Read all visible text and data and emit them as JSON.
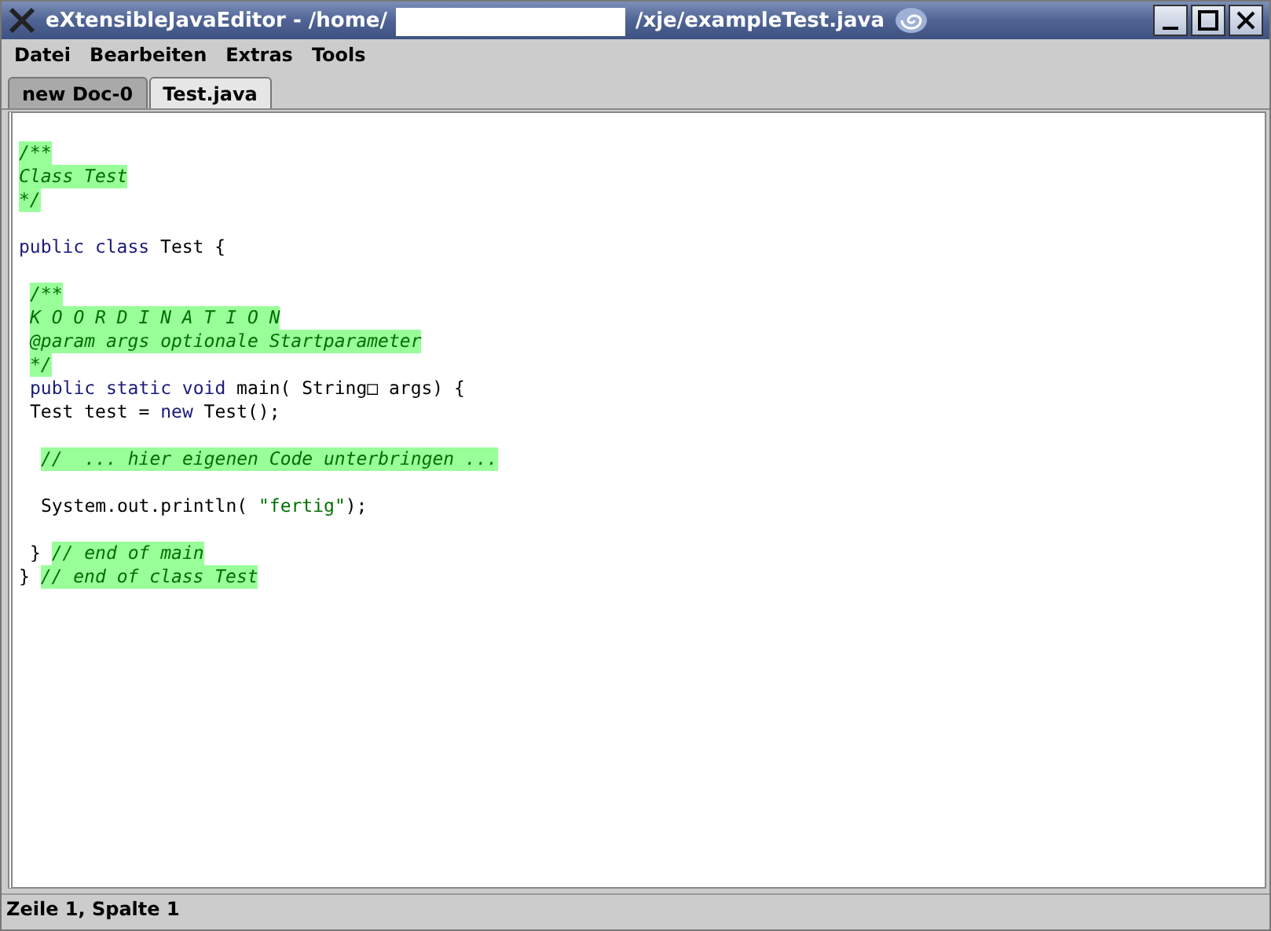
{
  "window": {
    "title_start": "eXtensibleJavaEditor - /home/",
    "title_end": "/xje/exampleTest.java"
  },
  "menu": [
    "Datei",
    "Bearbeiten",
    "Extras",
    "Tools"
  ],
  "tabs": [
    {
      "label": "new Doc-0",
      "selected": false
    },
    {
      "label": "Test.java",
      "selected": true
    }
  ],
  "editor": {
    "lines": [
      {
        "kind": "outer",
        "tokens": [
          {
            "text": "/**",
            "kind": "comment"
          }
        ]
      },
      {
        "kind": "outer",
        "tokens": [
          {
            "text": "Class Test",
            "kind": "comment"
          }
        ]
      },
      {
        "kind": "outer",
        "tokens": [
          {
            "text": "*/",
            "kind": "comment"
          }
        ]
      },
      {
        "kind": "blank"
      },
      {
        "kind": "outer",
        "tokens": [
          {
            "text": "public class",
            "kind": "keyword"
          },
          {
            "text": " Test {",
            "kind": "plain"
          }
        ]
      },
      {
        "kind": "blank"
      },
      {
        "kind": "inner",
        "tokens": [
          {
            "text": "/**",
            "kind": "comment"
          }
        ]
      },
      {
        "kind": "inner",
        "tokens": [
          {
            "text": "K O O R D I N A T I O N",
            "kind": "comment"
          }
        ]
      },
      {
        "kind": "inner",
        "tokens": [
          {
            "text": "@param args optionale Startparameter",
            "kind": "comment"
          }
        ]
      },
      {
        "kind": "inner",
        "tokens": [
          {
            "text": "*/",
            "kind": "comment"
          }
        ]
      },
      {
        "kind": "inner",
        "tokens": [
          {
            "text": "public static void",
            "kind": "keyword"
          },
          {
            "text": " main( String□ args) {",
            "kind": "plain"
          }
        ]
      },
      {
        "kind": "inner",
        "tokens": [
          {
            "text": "Test test = ",
            "kind": "plain"
          },
          {
            "text": "new",
            "kind": "keyword"
          },
          {
            "text": " Test();",
            "kind": "plain"
          }
        ]
      },
      {
        "kind": "blank"
      },
      {
        "kind": "deep",
        "tokens": [
          {
            "text": "//  ... hier eigenen Code unterbringen ...",
            "kind": "comment"
          }
        ]
      },
      {
        "kind": "blank"
      },
      {
        "kind": "deep",
        "tokens": [
          {
            "text": "System.out.println( ",
            "kind": "plain"
          },
          {
            "text": "\"fertig\"",
            "kind": "string"
          },
          {
            "text": ");",
            "kind": "plain"
          }
        ]
      },
      {
        "kind": "blank"
      },
      {
        "kind": "inner",
        "tokens": [
          {
            "text": "} ",
            "kind": "plain"
          },
          {
            "text": "// end of main",
            "kind": "comment"
          }
        ]
      },
      {
        "kind": "outer",
        "tokens": [
          {
            "text": "} ",
            "kind": "plain"
          },
          {
            "text": "// end of class Test",
            "kind": "comment"
          }
        ]
      }
    ]
  },
  "status_bar": "Zeile 1, Spalte 1"
}
